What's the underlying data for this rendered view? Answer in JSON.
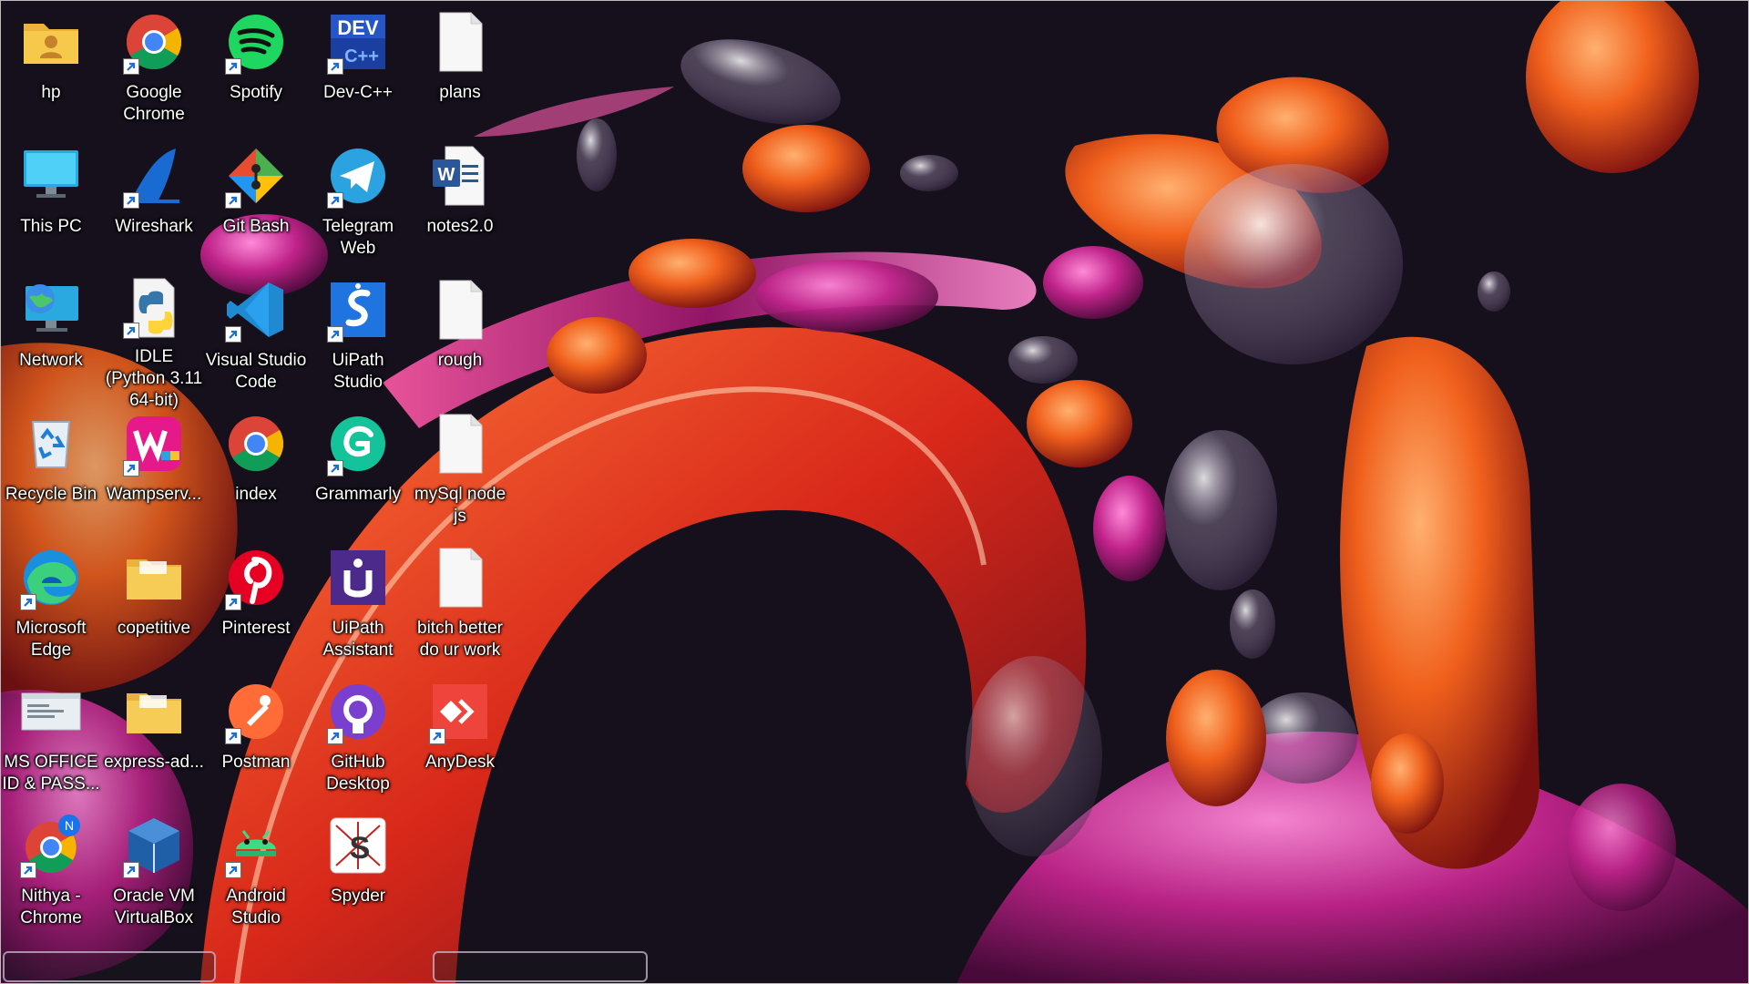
{
  "desktop": {
    "icons": [
      {
        "label": "hp",
        "icon": "user-folder-icon",
        "shortcut": false
      },
      {
        "label": "This PC",
        "icon": "monitor-icon",
        "shortcut": false
      },
      {
        "label": "Network",
        "icon": "network-icon",
        "shortcut": false
      },
      {
        "label": "Recycle Bin",
        "icon": "recycle-bin-icon",
        "shortcut": false
      },
      {
        "label": "Microsoft Edge",
        "icon": "edge-icon",
        "shortcut": true
      },
      {
        "label": "MS OFFICE ID & PASS...",
        "icon": "text-document-icon",
        "shortcut": false
      },
      {
        "label": "Nithya - Chrome",
        "icon": "chrome-profile-icon",
        "shortcut": true
      },
      {
        "label": "Google Chrome",
        "icon": "chrome-icon",
        "shortcut": true
      },
      {
        "label": "Wireshark",
        "icon": "wireshark-icon",
        "shortcut": true
      },
      {
        "label": "IDLE (Python 3.11 64-bit)",
        "icon": "python-icon",
        "shortcut": true
      },
      {
        "label": "Wampserv...",
        "icon": "wampserver-icon",
        "shortcut": true
      },
      {
        "label": "copetitive",
        "icon": "folder-icon",
        "shortcut": false
      },
      {
        "label": "express-ad...",
        "icon": "folder-icon",
        "shortcut": false
      },
      {
        "label": "Oracle VM VirtualBox",
        "icon": "virtualbox-icon",
        "shortcut": true
      },
      {
        "label": "Spotify",
        "icon": "spotify-icon",
        "shortcut": true
      },
      {
        "label": "Git Bash",
        "icon": "git-bash-icon",
        "shortcut": true
      },
      {
        "label": "Visual Studio Code",
        "icon": "vscode-icon",
        "shortcut": true
      },
      {
        "label": "index",
        "icon": "chrome-icon",
        "shortcut": false
      },
      {
        "label": "Pinterest",
        "icon": "pinterest-icon",
        "shortcut": true
      },
      {
        "label": "Postman",
        "icon": "postman-icon",
        "shortcut": true
      },
      {
        "label": "Android Studio",
        "icon": "android-studio-icon",
        "shortcut": true
      },
      {
        "label": "Dev-C++",
        "icon": "devcpp-icon",
        "shortcut": true
      },
      {
        "label": "Telegram Web",
        "icon": "telegram-icon",
        "shortcut": true
      },
      {
        "label": "UiPath Studio",
        "icon": "uipath-studio-icon",
        "shortcut": true
      },
      {
        "label": "Grammarly",
        "icon": "grammarly-icon",
        "shortcut": true
      },
      {
        "label": "UiPath Assistant",
        "icon": "uipath-assistant-icon",
        "shortcut": false
      },
      {
        "label": "GitHub Desktop",
        "icon": "github-icon",
        "shortcut": true
      },
      {
        "label": "Spyder",
        "icon": "spyder-icon",
        "shortcut": false
      },
      {
        "label": "plans",
        "icon": "blank-document-icon",
        "shortcut": false
      },
      {
        "label": "notes2.0",
        "icon": "word-document-icon",
        "shortcut": false
      },
      {
        "label": "rough",
        "icon": "blank-document-icon",
        "shortcut": false
      },
      {
        "label": "mySql node js",
        "icon": "blank-document-icon",
        "shortcut": false
      },
      {
        "label": "bitch better do ur work",
        "icon": "blank-document-icon",
        "shortcut": false
      },
      {
        "label": "AnyDesk",
        "icon": "anydesk-icon",
        "shortcut": true
      }
    ]
  },
  "colors": {
    "background": "#14101a",
    "wallpaper_orange": "#e8561e",
    "wallpaper_magenta": "#b4207a",
    "label_text": "#ffffff"
  }
}
